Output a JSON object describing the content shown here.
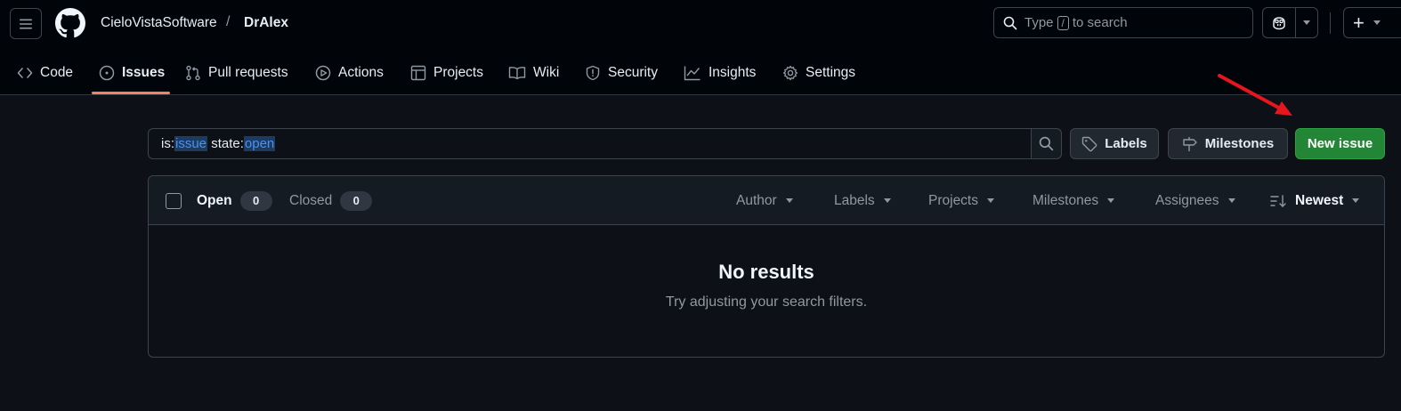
{
  "header": {
    "owner": "CieloVistaSoftware",
    "separator": "/",
    "repo": "DrAlex",
    "search_prefix": "Type",
    "search_key": "/",
    "search_suffix": "to search",
    "plus_label": "+"
  },
  "repo_nav": [
    {
      "label": "Code",
      "icon": "code-icon"
    },
    {
      "label": "Issues",
      "icon": "issue-opened-icon",
      "active": true
    },
    {
      "label": "Pull requests",
      "icon": "git-pull-request-icon"
    },
    {
      "label": "Actions",
      "icon": "play-icon"
    },
    {
      "label": "Projects",
      "icon": "table-icon"
    },
    {
      "label": "Wiki",
      "icon": "book-icon"
    },
    {
      "label": "Security",
      "icon": "shield-icon"
    },
    {
      "label": "Insights",
      "icon": "graph-icon"
    },
    {
      "label": "Settings",
      "icon": "gear-icon"
    }
  ],
  "filter": {
    "q1_key": "is:",
    "q1_val": "issue",
    "q2_key": "state:",
    "q2_val": "open"
  },
  "actions": {
    "labels": "Labels",
    "milestones": "Milestones",
    "new_issue": "New issue"
  },
  "issues_list": {
    "open_label": "Open",
    "open_count": "0",
    "closed_label": "Closed",
    "closed_count": "0",
    "filters": [
      "Author",
      "Labels",
      "Projects",
      "Milestones",
      "Assignees"
    ],
    "sort_label": "Newest",
    "empty_title": "No results",
    "empty_body": "Try adjusting your search filters."
  },
  "colors": {
    "accent_underline": "#f78166",
    "primary_button": "#238636",
    "annotation_arrow": "#e5161d"
  }
}
